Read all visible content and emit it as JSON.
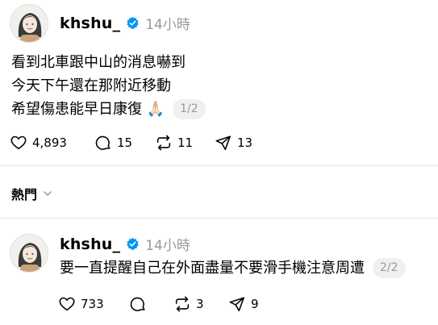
{
  "posts": [
    {
      "username": "khshu_",
      "time": "14小時",
      "lines": [
        "看到北車跟中山的消息嚇到",
        "今天下午還在那附近移動",
        "希望傷患能早日康復 🙏🏻"
      ],
      "page": "1/2",
      "likes": "4,893",
      "comments": "15",
      "reposts": "11",
      "shares": "13"
    },
    {
      "username": "khshu_",
      "time": "14小時",
      "lines": [
        "要一直提醒自己在外面盡量不要滑手機注意周遭"
      ],
      "page": "2/2",
      "likes": "733",
      "comments": "",
      "reposts": "3",
      "shares": "9"
    }
  ],
  "tab": {
    "label": "熱門"
  },
  "colors": {
    "verified": "#0095f6",
    "muted": "#999999",
    "divider": "#e6e6e6"
  },
  "icons": [
    "heart-icon",
    "comment-icon",
    "repost-icon",
    "share-icon",
    "verified-badge-icon",
    "chevron-down-icon"
  ]
}
